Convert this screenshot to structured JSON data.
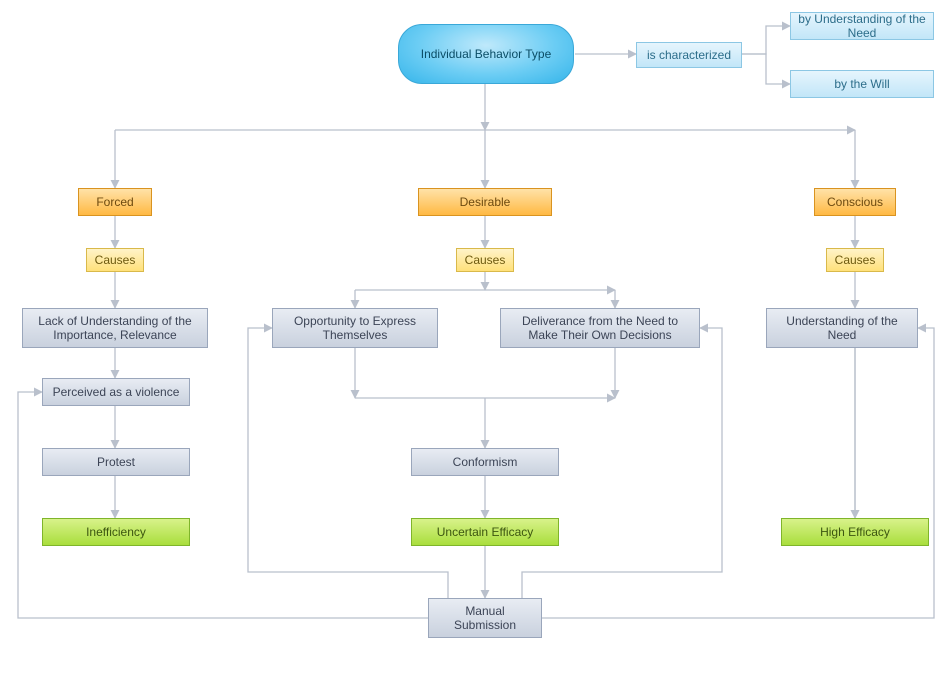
{
  "root": {
    "label": "Individual Behavior Type"
  },
  "characterized": {
    "link": "is characterized",
    "byNeed": "by Understanding of the Need",
    "byWill": "by the Will"
  },
  "branches": {
    "forced": {
      "title": "Forced",
      "causes": "Causes",
      "n1": "Lack of Understanding of the Importance, Relevance",
      "n2": "Perceived as a violence",
      "n3": "Protest",
      "outcome": "Inefficiency"
    },
    "desirable": {
      "title": "Desirable",
      "causes": "Causes",
      "left": "Opportunity to Express Themselves",
      "right": "Deliverance from the Need to Make Their Own Decisions",
      "mid": "Conformism",
      "outcome": "Uncertain Efficacy",
      "manual": "Manual Submission"
    },
    "conscious": {
      "title": "Conscious",
      "causes": "Causes",
      "n1": "Understanding of the Need",
      "outcome": "High Efficacy"
    }
  }
}
